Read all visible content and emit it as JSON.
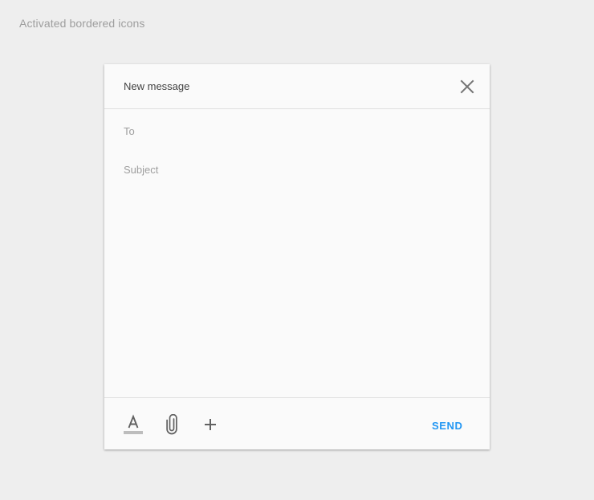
{
  "page": {
    "caption": "Activated bordered icons"
  },
  "dialog": {
    "title": "New message",
    "fields": {
      "to_placeholder": "To",
      "subject_placeholder": "Subject"
    },
    "toolbar": {
      "icons": [
        "format-text-icon",
        "attach-icon",
        "add-icon"
      ],
      "send_label": "SEND"
    },
    "header_icon": "close-icon"
  },
  "colors": {
    "background": "#eeeeee",
    "dialog_background": "#fafafa",
    "accent": "#2196f3",
    "icon": "#757575",
    "divider": "#e0e0e0",
    "placeholder": "#9e9e9e"
  }
}
